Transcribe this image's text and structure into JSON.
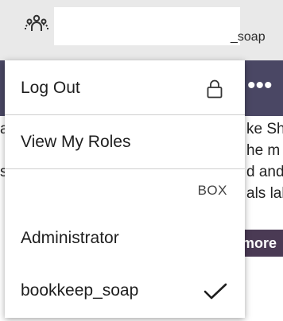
{
  "topbar": {
    "user_icon": "people-group-icon",
    "username_visible_suffix": "_soap"
  },
  "background": {
    "text_lines_right": [
      "ke Shi",
      "he m",
      "d and",
      "als lal"
    ],
    "text_lines_left": [
      "a",
      "",
      "s",
      ""
    ],
    "more_button": "more",
    "dots_icon": "more-horizontal-icon"
  },
  "menu": {
    "logout_label": "Log Out",
    "logout_icon": "lock-icon",
    "view_roles_label": "View My Roles",
    "roles_section_label": "BOX",
    "roles": [
      {
        "label": "Administrator",
        "selected": false
      },
      {
        "label": "bookkeep_soap",
        "selected": true,
        "icon": "checkmark-icon"
      }
    ]
  }
}
